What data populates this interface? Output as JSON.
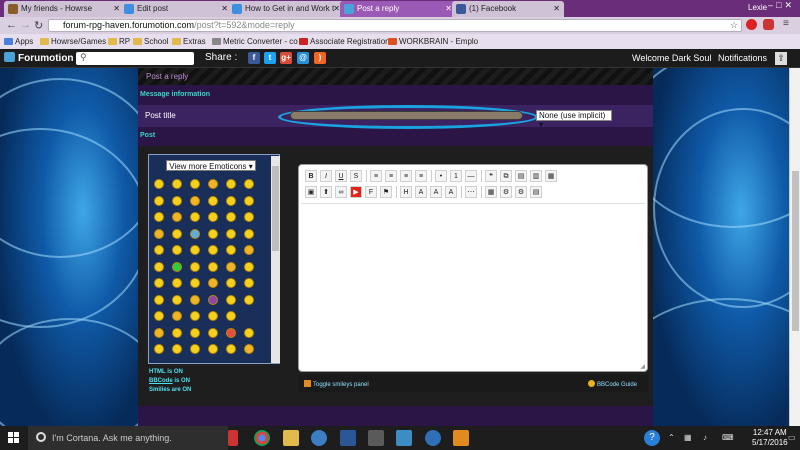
{
  "browser": {
    "tabs": [
      {
        "label": "My friends - Howrse",
        "active": false
      },
      {
        "label": "Edit post",
        "active": false
      },
      {
        "label": "How to Get in and Work t",
        "active": false
      },
      {
        "label": "Post a reply",
        "active": true
      },
      {
        "label": "(1) Facebook",
        "active": false
      }
    ],
    "profile": "Lexie",
    "url_host": "forum-rpg-haven.forumotion.com",
    "url_path": "/post?t=592&mode=reply",
    "bookmarks": [
      "Apps",
      "Howrse/Games",
      "RP",
      "School",
      "Extras",
      "Metric Converter - co",
      "Associate Registration",
      "WORKBRAIN - Emplo"
    ]
  },
  "forum_bar": {
    "logo": "Forumotion",
    "share_label": "Share :",
    "welcome": "Welcome Dark Soul",
    "notifications": "Notifications"
  },
  "page": {
    "header_title": "Post a reply",
    "message_info_label": "Message information",
    "post_title_label": "Post title",
    "post_title_value": "",
    "icon_select_value": "None (use implicit)",
    "post_label": "Post",
    "emoticons_select": "View more Emoticons",
    "html_status": "HTML is ON",
    "bbcode_status_link": "BBCode",
    "bbcode_status_suffix": " is ON",
    "smilies_status": "Smilies are ON",
    "toggle_smileys": "Toggle smileys panel",
    "bbcode_guide": "BBCode Guide"
  },
  "taskbar": {
    "search_placeholder": "I'm Cortana. Ask me anything.",
    "time": "12:47 AM",
    "date": "5/17/2016"
  },
  "colors": {
    "accent_teal": "#39d7c6",
    "annotation_ellipse": "#19a3e0",
    "active_tab": "#9b59b6"
  }
}
